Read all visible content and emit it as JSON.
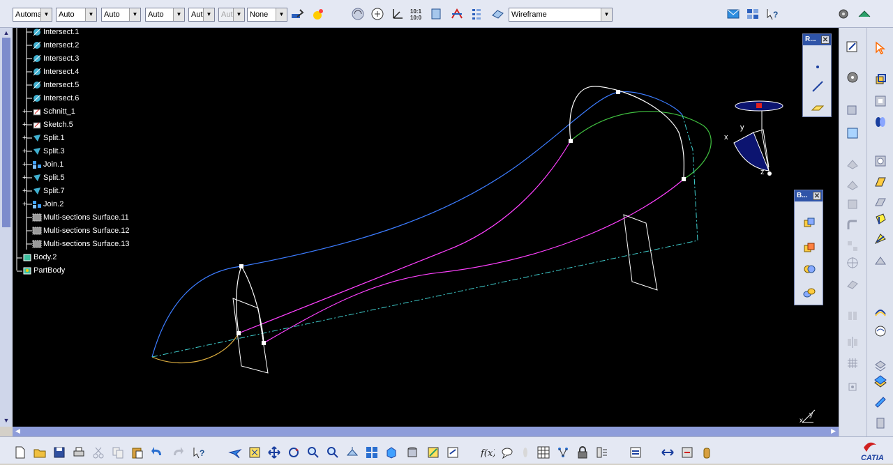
{
  "toolbar": {
    "combos": [
      {
        "value": "Automa",
        "disabled": false
      },
      {
        "value": "Auto",
        "disabled": false
      },
      {
        "value": "Auto",
        "disabled": false
      },
      {
        "value": "Auto",
        "disabled": false
      },
      {
        "value": "Aut",
        "disabled": false
      },
      {
        "value": "Aut",
        "disabled": true
      },
      {
        "value": "None",
        "disabled": false
      }
    ],
    "render_style": "Wireframe"
  },
  "tree": {
    "items": [
      {
        "label": "Intersect.1",
        "icon": "intersect-icon"
      },
      {
        "label": "Intersect.2",
        "icon": "intersect-icon"
      },
      {
        "label": "Intersect.3",
        "icon": "intersect-icon"
      },
      {
        "label": "Intersect.4",
        "icon": "intersect-icon"
      },
      {
        "label": "Intersect.5",
        "icon": "intersect-icon"
      },
      {
        "label": "Intersect.6",
        "icon": "intersect-icon"
      },
      {
        "label": "Schnitt_1",
        "icon": "sketch-icon"
      },
      {
        "label": "Sketch.5",
        "icon": "sketch-icon"
      },
      {
        "label": "Split.1",
        "icon": "split-icon"
      },
      {
        "label": "Split.3",
        "icon": "split-icon"
      },
      {
        "label": "Join.1",
        "icon": "join-icon"
      },
      {
        "label": "Split.5",
        "icon": "split-icon"
      },
      {
        "label": "Split.7",
        "icon": "split-icon"
      },
      {
        "label": "Join.2",
        "icon": "join-icon"
      },
      {
        "label": "Multi-sections Surface.11",
        "icon": "multi-sections-surface-icon"
      },
      {
        "label": "Multi-sections Surface.12",
        "icon": "multi-sections-surface-icon"
      },
      {
        "label": "Multi-sections Surface.13",
        "icon": "multi-sections-surface-icon"
      },
      {
        "label": "Body.2",
        "icon": "body-icon"
      },
      {
        "label": "PartBody",
        "icon": "partbody-icon"
      }
    ]
  },
  "compass": {
    "x_label": "x",
    "y_label": "y",
    "z_label": "z"
  },
  "corner_axis": {
    "x_label": "x",
    "y_label": "y"
  },
  "panels": {
    "reference": {
      "title": "R..."
    },
    "boolean": {
      "title": "B..."
    }
  },
  "brand": {
    "logo_text": "CATIA"
  },
  "colors": {
    "viewport_bg": "#000000",
    "curve_blue": "#3c7cff",
    "curve_magenta": "#ff40ff",
    "curve_green": "#40c040",
    "curve_cyan": "#40d0d0",
    "curve_orange": "#e0b040",
    "curve_white": "#ffffff"
  }
}
